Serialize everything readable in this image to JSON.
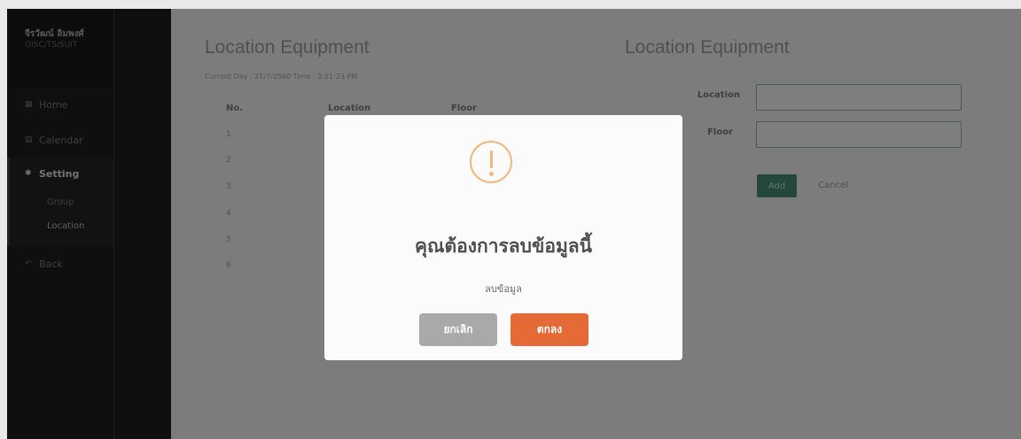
{
  "sidebar": {
    "user_name": "จีรวัฒน์ ลิมพงศ์",
    "user_id": "GISC/TS/SUIT",
    "items": [
      {
        "label": "Home",
        "icon": "grid-icon"
      },
      {
        "label": "Calendar",
        "icon": "calendar-icon"
      },
      {
        "label": "Setting",
        "icon": "gear-icon"
      },
      {
        "label": "Back",
        "icon": "reply-icon"
      }
    ],
    "sub_items": [
      "Group",
      "Location"
    ]
  },
  "main": {
    "title_left": "Location Equipment",
    "current_text": "Current  Day :  21/7/2560  Time :  3:21:23 PM",
    "table": {
      "headers": [
        "No.",
        "Location",
        "Floor"
      ],
      "rows": [
        "1",
        "2",
        "3",
        "4",
        "5",
        "6"
      ]
    },
    "form": {
      "title": "Location Equipment",
      "location_label": "Location",
      "floor_label": "Floor",
      "add_label": "Add",
      "cancel_label": "Cancel"
    }
  },
  "modal": {
    "icon": "warning-icon",
    "title": "คุณต้องการลบข้อมูลนี้",
    "text": "ลบข้อมูล",
    "cancel_label": "ยกเลิก",
    "confirm_label": "ตกลง",
    "colors": {
      "confirm": "#e46a36",
      "cancel": "#a9a9a9",
      "warning": "#f2b87a"
    }
  }
}
